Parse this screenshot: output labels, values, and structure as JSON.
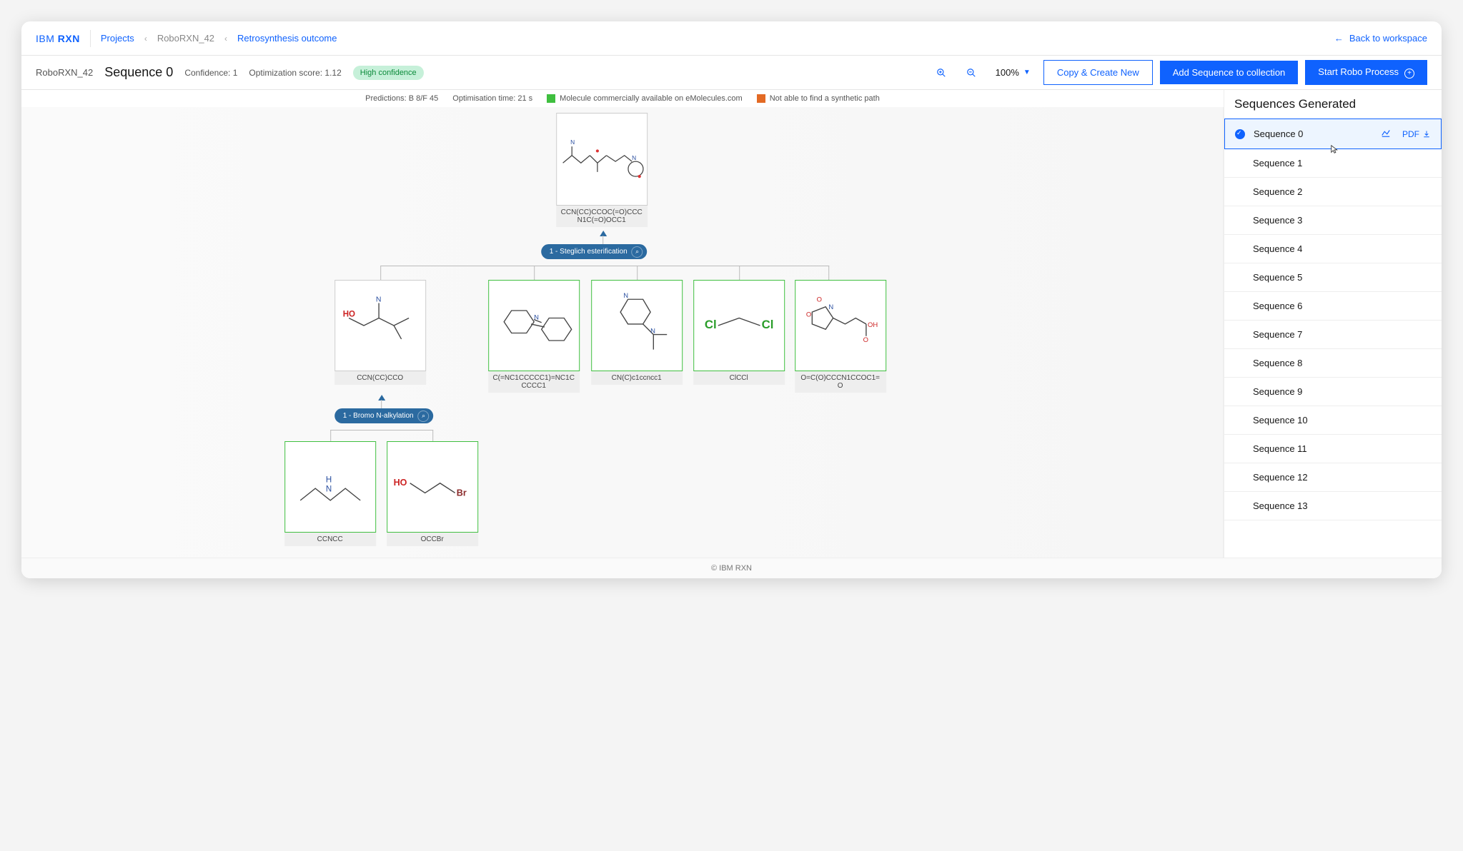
{
  "nav": {
    "logo_prefix": "IBM",
    "logo_suffix": "RXN",
    "crumb_projects": "Projects",
    "crumb_project": "RoboRXN_42",
    "crumb_current": "Retrosynthesis outcome",
    "back_label": "Back to workspace"
  },
  "header": {
    "project": "RoboRXN_42",
    "sequence_title": "Sequence 0",
    "confidence_label": "Confidence: 1",
    "opt_label": "Optimization score: 1.12",
    "badge": "High confidence",
    "zoom": "100%",
    "btn_copy": "Copy & Create New",
    "btn_add": "Add Sequence to collection",
    "btn_start": "Start Robo Process"
  },
  "legend": {
    "predictions": "Predictions: B 8/F 45",
    "opt_time": "Optimisation time: 21 s",
    "green": "Molecule commercially available on eMolecules.com",
    "orange": "Not able to find a synthetic path"
  },
  "tree": {
    "target_smiles": "CCN(CC)CCOC(=O)CCCN1C(=O)OCC1",
    "step1": "1 - Steglich esterification",
    "step2": "1 - Bromo N-alkylation",
    "row1": {
      "m0": "CCN(CC)CCO",
      "m1": "C(=NC1CCCCC1)=NC1CCCCC1",
      "m2": "CN(C)c1ccncc1",
      "m3": "ClCCl",
      "m4": "O=C(O)CCCN1CCOC1=O"
    },
    "row2": {
      "m0": "CCNCC",
      "m1": "OCCBr"
    }
  },
  "right": {
    "title": "Sequences Generated",
    "pdf": "PDF",
    "items": [
      "Sequence 0",
      "Sequence 1",
      "Sequence 2",
      "Sequence 3",
      "Sequence 4",
      "Sequence 5",
      "Sequence 6",
      "Sequence 7",
      "Sequence 8",
      "Sequence 9",
      "Sequence 10",
      "Sequence 11",
      "Sequence 12",
      "Sequence 13"
    ]
  },
  "footer": "© IBM RXN"
}
